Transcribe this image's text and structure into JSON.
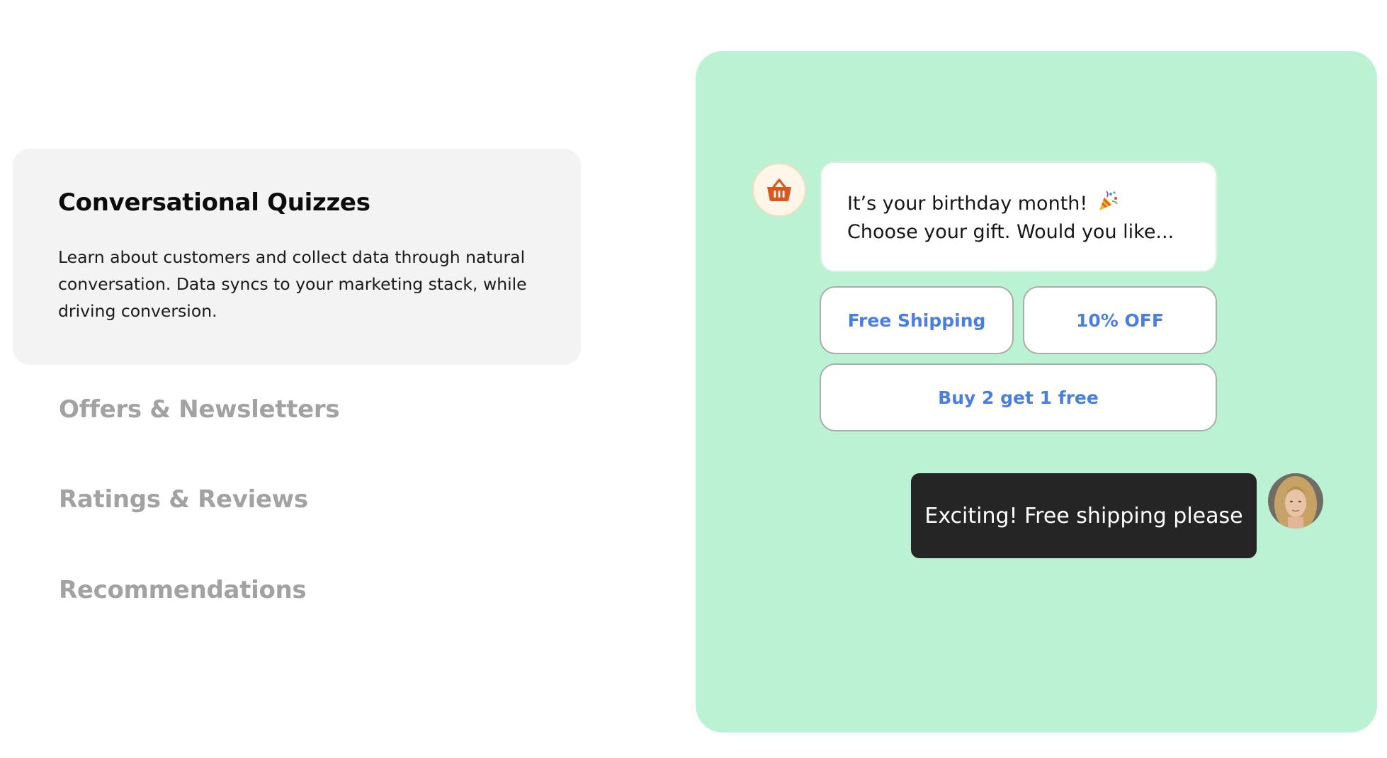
{
  "features": {
    "active": {
      "title": "Conversational Quizzes",
      "description": "Learn about customers and collect data through natural conversation. Data syncs to your marketing stack, while driving conversion."
    },
    "tabs": [
      {
        "label": "Offers & Newsletters"
      },
      {
        "label": "Ratings & Reviews"
      },
      {
        "label": "Recommendations"
      }
    ]
  },
  "chat": {
    "bot_icon": "basket-icon",
    "bot_message_line1": "It’s your birthday month!",
    "bot_message_line2": "Choose your gift. Would you like...",
    "emoji_icon": "party-popper-icon",
    "options": [
      {
        "label": "Free Shipping"
      },
      {
        "label": "10% OFF"
      },
      {
        "label": "Buy 2 get 1 free"
      }
    ],
    "user_message": "Exciting! Free shipping please",
    "user_avatar": "user-avatar-photo"
  },
  "colors": {
    "panel_bg": "#bbf2d4",
    "option_text": "#4a7ee0",
    "basket_icon": "#d8591e",
    "user_bubble": "#252525"
  }
}
